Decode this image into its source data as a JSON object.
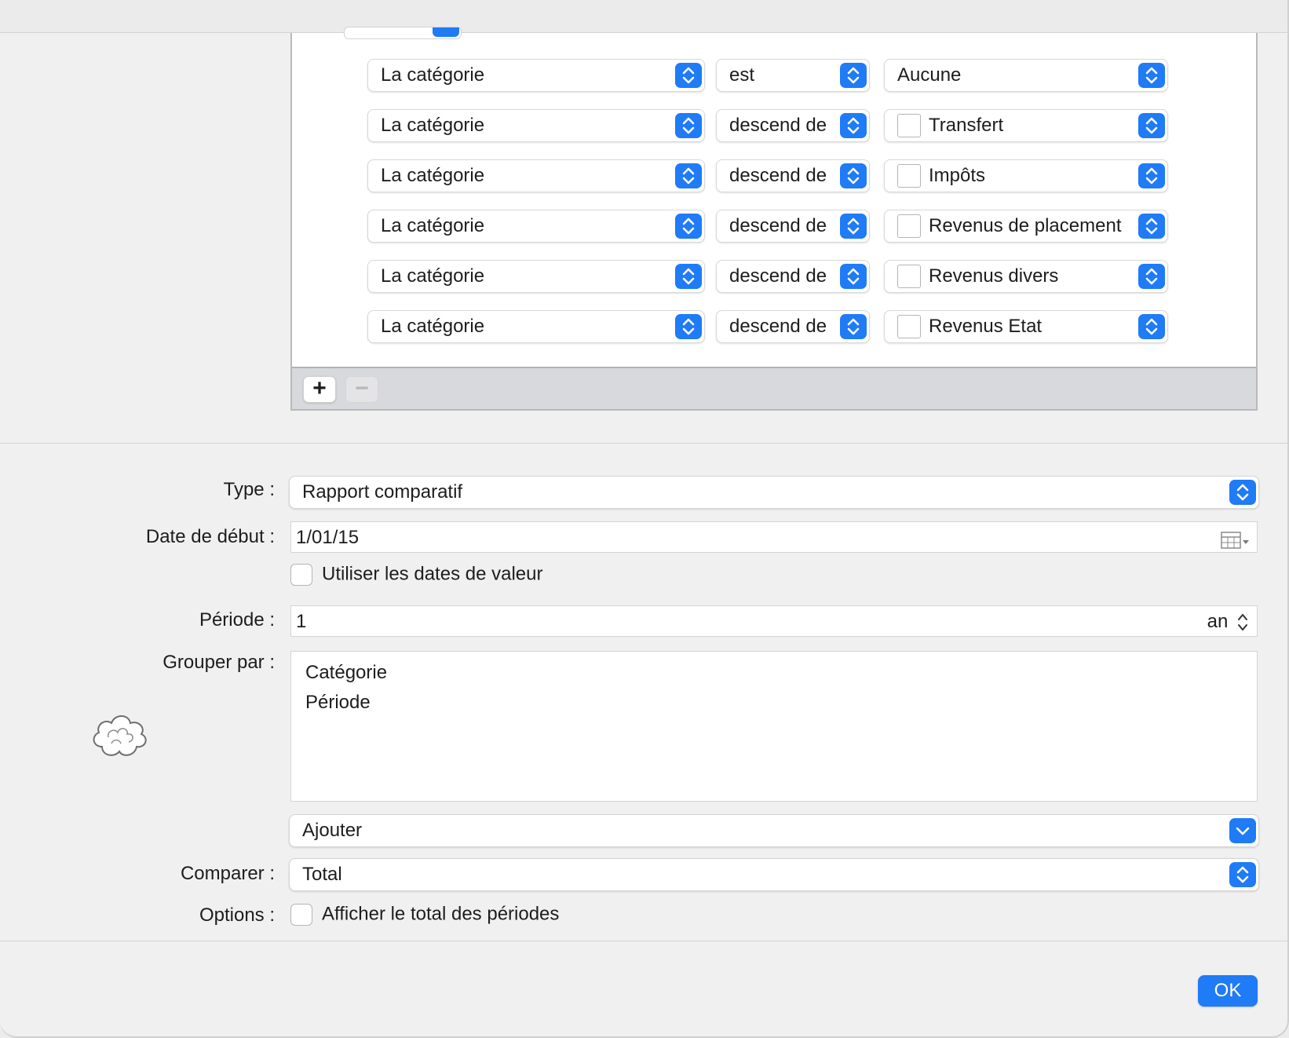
{
  "rules": {
    "rows": [
      {
        "field": "La catégorie",
        "operator": "est",
        "value": "Aucune",
        "has_checkbox": false
      },
      {
        "field": "La catégorie",
        "operator": "descend de",
        "value": "Transfert",
        "has_checkbox": true
      },
      {
        "field": "La catégorie",
        "operator": "descend de",
        "value": "Impôts",
        "has_checkbox": true
      },
      {
        "field": "La catégorie",
        "operator": "descend de",
        "value": "Revenus de placement",
        "has_checkbox": true
      },
      {
        "field": "La catégorie",
        "operator": "descend de",
        "value": "Revenus divers",
        "has_checkbox": true
      },
      {
        "field": "La catégorie",
        "operator": "descend de",
        "value": "Revenus Etat",
        "has_checkbox": true
      }
    ],
    "add_label": "+",
    "remove_label": "−"
  },
  "form": {
    "type_label": "Type :",
    "type_value": "Rapport comparatif",
    "start_date_label": "Date de début :",
    "start_date_value": "1/01/15",
    "value_dates_label": "Utiliser les dates de valeur",
    "period_label": "Période :",
    "period_value": "1",
    "period_unit": "an",
    "group_by_label": "Grouper par :",
    "group_by_items": [
      "Catégorie",
      "Période"
    ],
    "add_value": "Ajouter",
    "compare_label": "Comparer :",
    "compare_value": "Total",
    "options_label": "Options :",
    "options_checkbox_label": "Afficher le total des périodes"
  },
  "ok_label": "OK",
  "colors": {
    "accent": "#1f7bf6"
  },
  "icons": {
    "calendar": "calendar-grid-icon",
    "stepper": "up-down-chevron-icon",
    "cloud": "cloud-icon"
  }
}
